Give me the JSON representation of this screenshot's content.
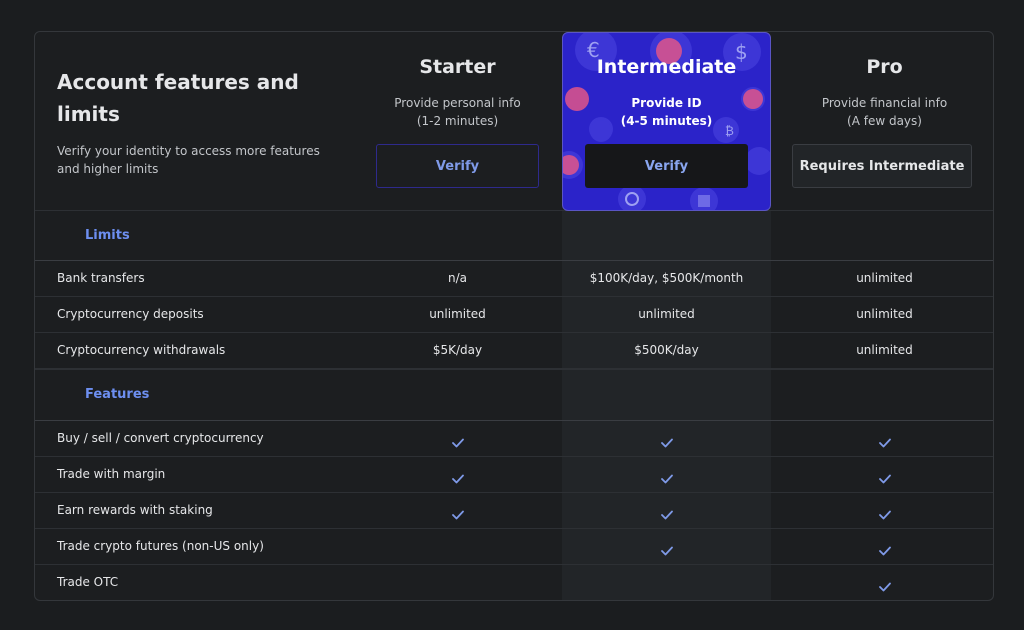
{
  "header": {
    "title": "Account features and limits",
    "subtitle": "Verify your identity to access more features and higher limits"
  },
  "plans": [
    {
      "name": "Starter",
      "desc_line1": "Provide personal info",
      "desc_line2": "(1-2 minutes)",
      "button": "Verify"
    },
    {
      "name": "Intermediate",
      "desc_line1": "Provide ID",
      "desc_line2": "(4-5 minutes)",
      "button": "Verify"
    },
    {
      "name": "Pro",
      "desc_line1": "Provide financial info",
      "desc_line2": "(A few days)",
      "button": "Requires Intermediate"
    }
  ],
  "limits": {
    "label": "Limits",
    "rows": [
      {
        "label": "Bank transfers",
        "values": [
          "n/a",
          "$100K/day, $500K/month",
          "unlimited"
        ]
      },
      {
        "label": "Cryptocurrency deposits",
        "values": [
          "unlimited",
          "unlimited",
          "unlimited"
        ]
      },
      {
        "label": "Cryptocurrency withdrawals",
        "values": [
          "$5K/day",
          "$500K/day",
          "unlimited"
        ]
      }
    ]
  },
  "features": {
    "label": "Features",
    "rows": [
      {
        "label": "Buy / sell / convert cryptocurrency",
        "checks": [
          true,
          true,
          true
        ]
      },
      {
        "label": "Trade with margin",
        "checks": [
          true,
          true,
          true
        ]
      },
      {
        "label": "Earn rewards with staking",
        "checks": [
          true,
          true,
          true
        ]
      },
      {
        "label": "Trade crypto futures (non-US only)",
        "checks": [
          false,
          true,
          true
        ]
      },
      {
        "label": "Trade OTC",
        "checks": [
          false,
          false,
          true
        ]
      }
    ]
  },
  "colors": {
    "accent": "#6d8ff0",
    "intermediate_bg": "#2b23c9",
    "check": "#7f9ae8"
  }
}
